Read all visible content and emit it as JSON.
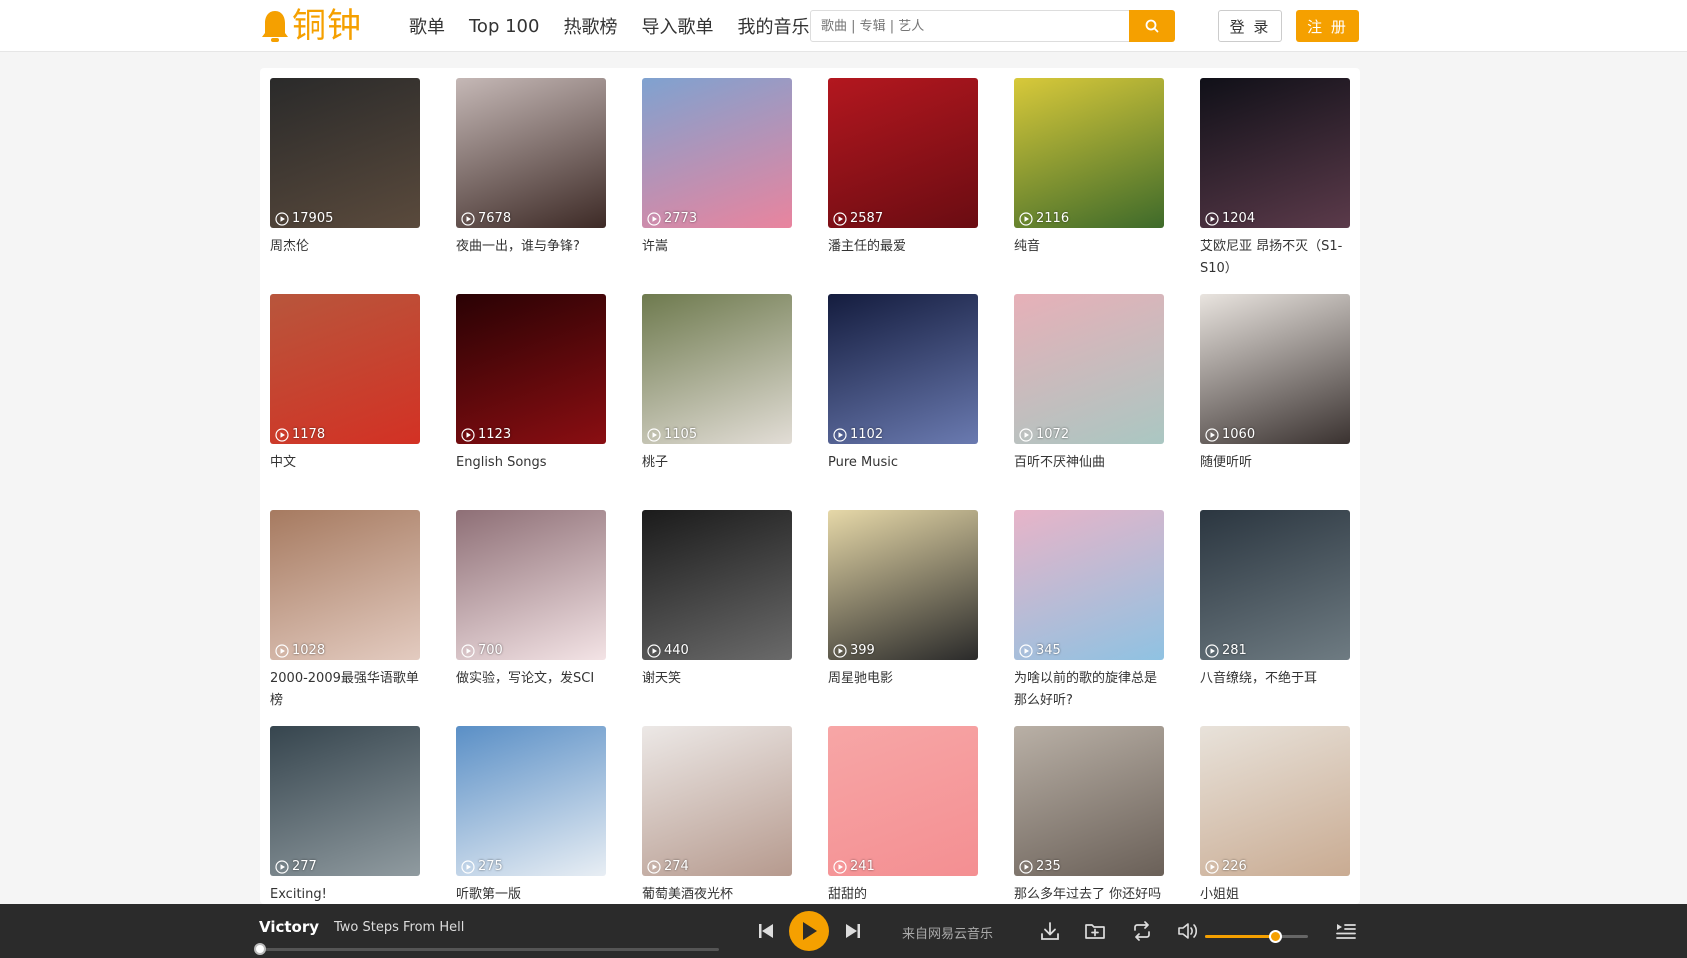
{
  "brand": {
    "name": "铜钟",
    "accent": "#f5a000"
  },
  "nav": {
    "items": [
      "歌单",
      "Top 100",
      "热歌榜",
      "导入歌单",
      "我的音乐"
    ]
  },
  "search": {
    "placeholder": "歌曲 | 专辑 | 艺人"
  },
  "auth": {
    "login_label": "登 录",
    "register_label": "注 册"
  },
  "playlists": [
    {
      "title": "周杰伦",
      "plays": "17905",
      "colors": [
        "#2a2a2a",
        "#5a4a3c"
      ]
    },
    {
      "title": "夜曲一出，谁与争锋?",
      "plays": "7678",
      "colors": [
        "#c5b8b6",
        "#3d2a26"
      ]
    },
    {
      "title": "许嵩",
      "plays": "2773",
      "colors": [
        "#7fa2d0",
        "#e9849e"
      ]
    },
    {
      "title": "潘主任的最爱",
      "plays": "2587",
      "colors": [
        "#b3171f",
        "#6a0c12"
      ]
    },
    {
      "title": "纯音",
      "plays": "2116",
      "colors": [
        "#d8c93a",
        "#3e6a2a"
      ]
    },
    {
      "title": "艾欧尼亚 昂扬不灭（S1-S10）",
      "plays": "1204",
      "colors": [
        "#101018",
        "#5b3a4a"
      ]
    },
    {
      "title": "中文",
      "plays": "1178",
      "colors": [
        "#b8563c",
        "#d33124"
      ]
    },
    {
      "title": "English Songs",
      "plays": "1123",
      "colors": [
        "#2a0204",
        "#8a0e12"
      ]
    },
    {
      "title": "桃子",
      "plays": "1105",
      "colors": [
        "#6e7a4e",
        "#e2ddd6"
      ]
    },
    {
      "title": "Pure Music",
      "plays": "1102",
      "colors": [
        "#141c3e",
        "#6a7ab0"
      ]
    },
    {
      "title": "百听不厌神仙曲",
      "plays": "1072",
      "colors": [
        "#e7b0b8",
        "#aac7c2"
      ]
    },
    {
      "title": "随便听听",
      "plays": "1060",
      "colors": [
        "#e9e4df",
        "#3a3230"
      ]
    },
    {
      "title": "2000-2009最强华语歌单榜",
      "plays": "1028",
      "colors": [
        "#a67a60",
        "#e3cbc0"
      ]
    },
    {
      "title": "做实验，写论文，发SCI",
      "plays": "700",
      "colors": [
        "#8e6f76",
        "#f3e3e5"
      ]
    },
    {
      "title": "谢天笑",
      "plays": "440",
      "colors": [
        "#1b1b1b",
        "#6a6a6a"
      ]
    },
    {
      "title": "周星驰电影",
      "plays": "399",
      "colors": [
        "#e6d8a8",
        "#2a2a2a"
      ]
    },
    {
      "title": "为啥以前的歌的旋律总是那么好听?",
      "plays": "345",
      "colors": [
        "#e7b4c8",
        "#8fc2e2"
      ]
    },
    {
      "title": "八音缭绕，不绝于耳",
      "plays": "281",
      "colors": [
        "#2b3640",
        "#6e7b82"
      ]
    },
    {
      "title": "Exciting!",
      "plays": "277",
      "colors": [
        "#36454e",
        "#909ba0"
      ]
    },
    {
      "title": "听歌第一版",
      "plays": "275",
      "colors": [
        "#5a8fc6",
        "#e8eef4"
      ]
    },
    {
      "title": "葡萄美酒夜光杯",
      "plays": "274",
      "colors": [
        "#ece8e6",
        "#b69a8e"
      ]
    },
    {
      "title": "甜甜的",
      "plays": "241",
      "colors": [
        "#f7a6a6",
        "#f48f92"
      ]
    },
    {
      "title": "那么多年过去了 你还好吗",
      "plays": "235",
      "colors": [
        "#b9b0a6",
        "#6a6058"
      ]
    },
    {
      "title": "小姐姐",
      "plays": "226",
      "colors": [
        "#e8e2da",
        "#c9ab92"
      ]
    }
  ],
  "player": {
    "song_title": "Victory",
    "artist": "Two Steps From Hell",
    "source": "来自网易云音乐",
    "progress": 0,
    "volume": 0.68
  }
}
